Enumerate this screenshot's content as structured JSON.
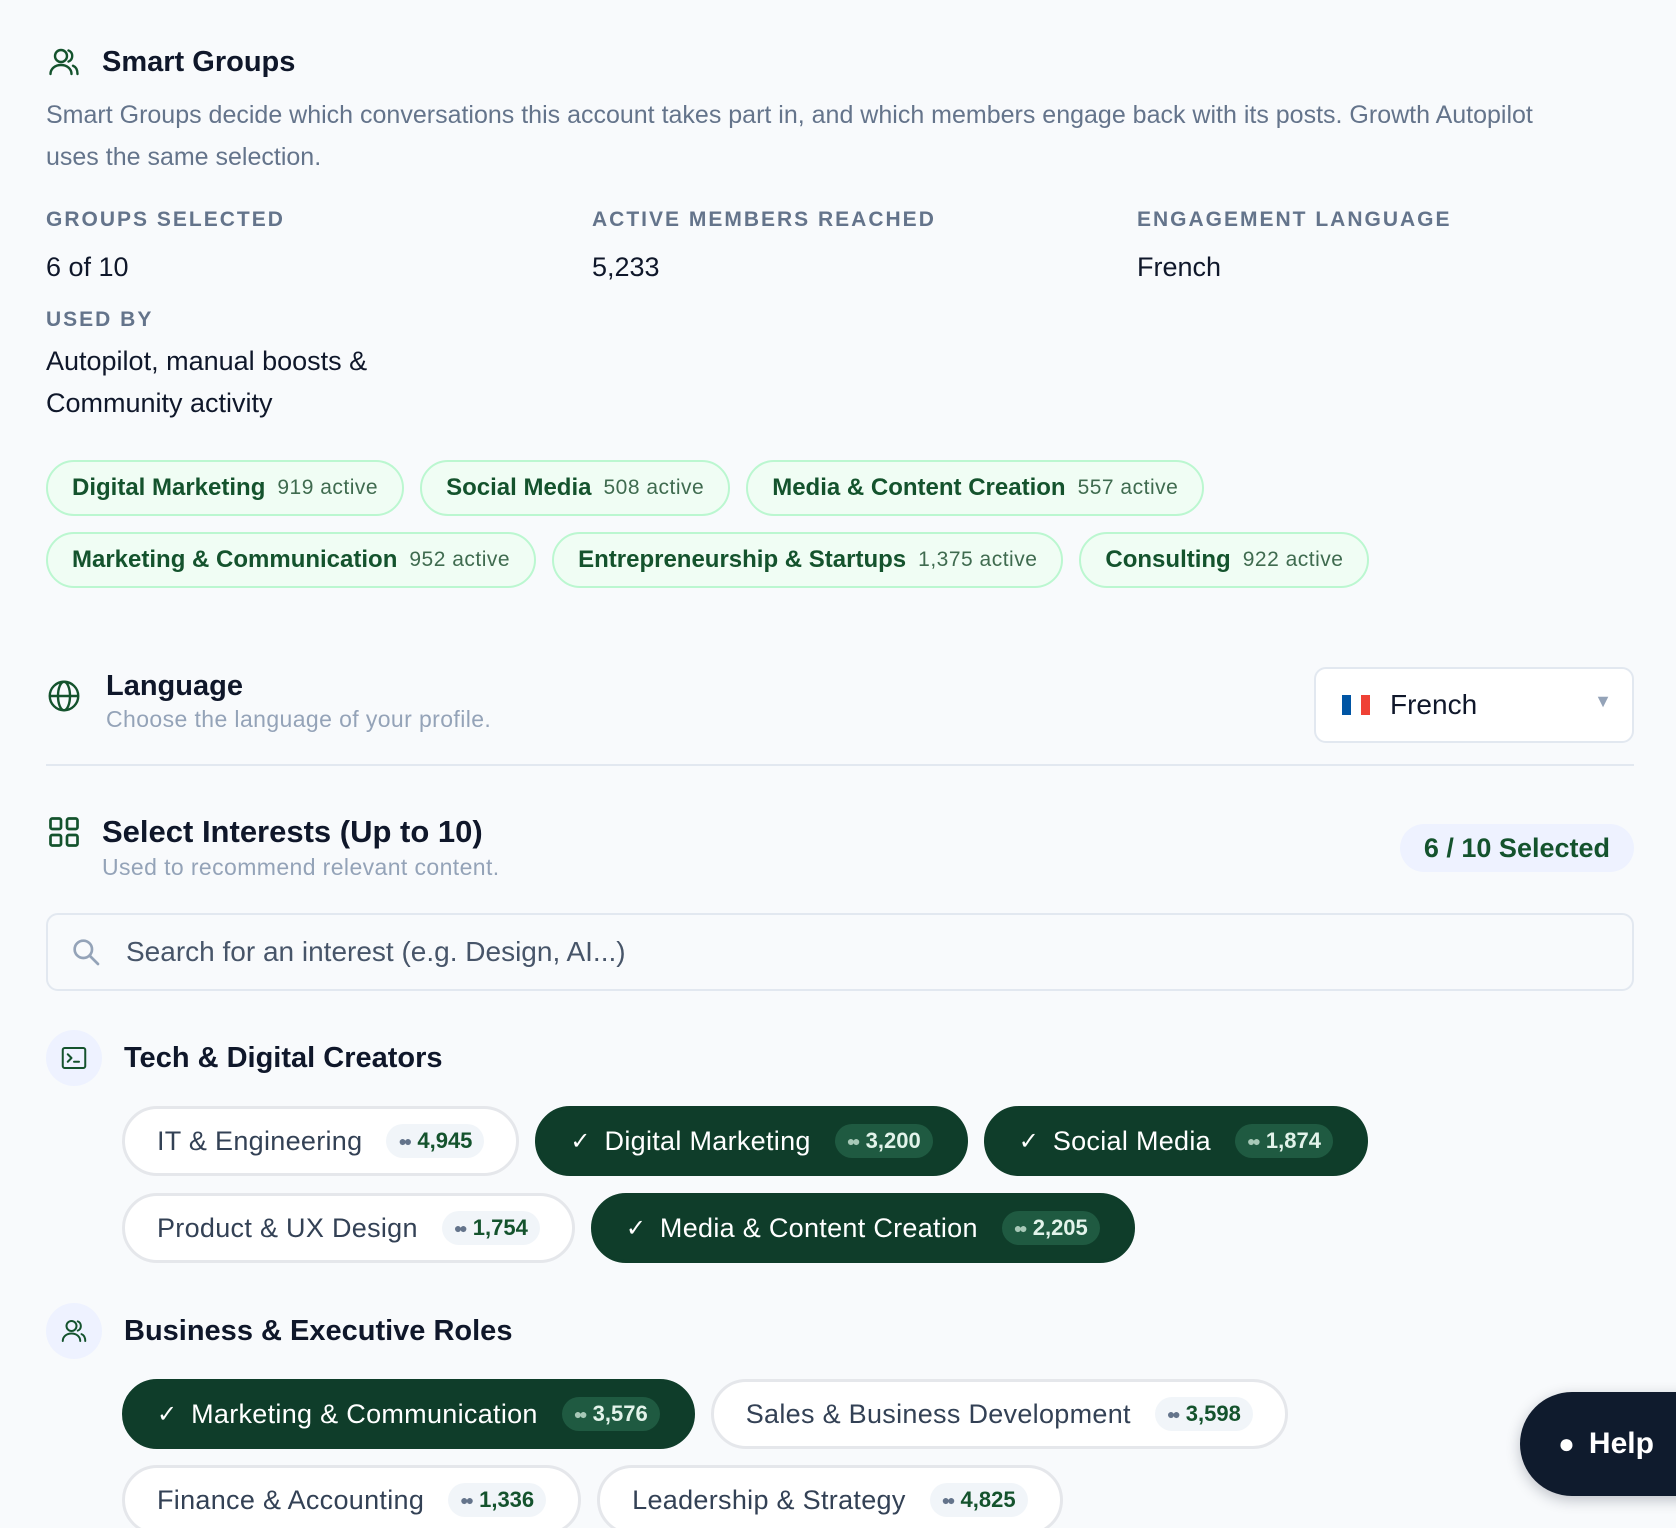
{
  "smart_groups": {
    "title": "Smart Groups",
    "description": "Smart Groups decide which conversations this account takes part in, and which members engage back with its posts. Growth Autopilot uses the same selection.",
    "stats": [
      {
        "label": "GROUPS SELECTED",
        "value": "6 of 10"
      },
      {
        "label": "ACTIVE MEMBERS REACHED",
        "value": "5,233"
      },
      {
        "label": "ENGAGEMENT LANGUAGE",
        "value": "French"
      },
      {
        "label": "USED BY",
        "value": "Autopilot, manual boosts & Community activity"
      }
    ],
    "groups": [
      {
        "name": "Digital Marketing",
        "active": "919 active"
      },
      {
        "name": "Social Media",
        "active": "508 active"
      },
      {
        "name": "Media & Content Creation",
        "active": "557 active"
      },
      {
        "name": "Marketing & Communication",
        "active": "952 active"
      },
      {
        "name": "Entrepreneurship & Startups",
        "active": "1,375 active"
      },
      {
        "name": "Consulting",
        "active": "922 active"
      }
    ]
  },
  "language": {
    "title": "Language",
    "subtitle": "Choose the language of your profile.",
    "selected": "French",
    "flag_colors": [
      "#0055a4",
      "#ffffff",
      "#ef4135"
    ]
  },
  "interests": {
    "title": "Select Interests (Up to 10)",
    "subtitle": "Used to recommend relevant content.",
    "selected_badge": "6 / 10 Selected",
    "search_placeholder": "Search for an interest (e.g. Design, AI...)",
    "categories": [
      {
        "title": "Tech & Digital Creators",
        "icon": "terminal-icon",
        "items": [
          {
            "name": "IT & Engineering",
            "count": "4,945",
            "selected": false
          },
          {
            "name": "Digital Marketing",
            "count": "3,200",
            "selected": true
          },
          {
            "name": "Social Media",
            "count": "1,874",
            "selected": true
          },
          {
            "name": "Product & UX Design",
            "count": "1,754",
            "selected": false
          },
          {
            "name": "Media & Content Creation",
            "count": "2,205",
            "selected": true
          }
        ]
      },
      {
        "title": "Business & Executive Roles",
        "icon": "users-icon",
        "items": [
          {
            "name": "Marketing & Communication",
            "count": "3,576",
            "selected": true
          },
          {
            "name": "Sales & Business Development",
            "count": "3,598",
            "selected": false
          },
          {
            "name": "Finance & Accounting",
            "count": "1,336",
            "selected": false
          },
          {
            "name": "Leadership & Strategy",
            "count": "4,825",
            "selected": false
          }
        ]
      }
    ]
  },
  "help": {
    "label": "Help"
  },
  "colors": {
    "accent": "#0f3d2a",
    "pill_bg": "#f0fdf4",
    "pill_border": "#bbf7d0",
    "help_bg": "#0f1b2d"
  }
}
